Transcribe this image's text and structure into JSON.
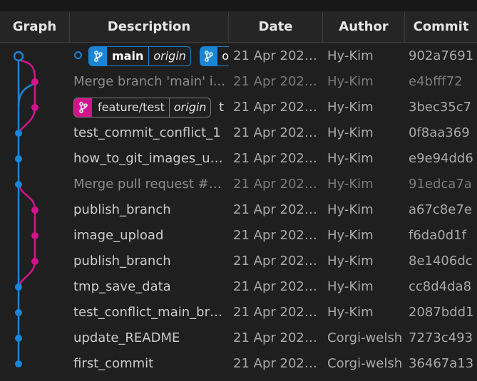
{
  "colors": {
    "blue": "#1a85d6",
    "pink": "#d2148c"
  },
  "columns": {
    "graph": "Graph",
    "description": "Description",
    "date": "Date",
    "author": "Author",
    "commit": "Commit"
  },
  "commits": [
    {
      "description": "",
      "date": "21 Apr 2025...",
      "author": "Hy-Kim",
      "commit": "902a7691",
      "dim": false,
      "lane": "blue",
      "head": true
    },
    {
      "description": "Merge branch 'main' i...",
      "date": "21 Apr 2025...",
      "author": "Hy-Kim",
      "commit": "e4bfff72",
      "dim": true,
      "lane": "pink"
    },
    {
      "description": "t",
      "date": "21 Apr 2025...",
      "author": "Hy-Kim",
      "commit": "3bec35c7",
      "dim": false,
      "lane": "pink"
    },
    {
      "description": "test_commit_conflict_1",
      "date": "21 Apr 2025...",
      "author": "Hy-Kim",
      "commit": "0f8aa369",
      "dim": false,
      "lane": "blue"
    },
    {
      "description": "how_to_git_images_up...",
      "date": "21 Apr 2025...",
      "author": "Hy-Kim",
      "commit": "e9e94dd6",
      "dim": false,
      "lane": "blue"
    },
    {
      "description": "Merge pull request #1 ...",
      "date": "21 Apr 2025...",
      "author": "Hy-Kim",
      "commit": "91edca7a",
      "dim": true,
      "lane": "blue"
    },
    {
      "description": "publish_branch",
      "date": "21 Apr 2025...",
      "author": "Hy-Kim",
      "commit": "a67c8e7e",
      "dim": false,
      "lane": "pink"
    },
    {
      "description": "image_upload",
      "date": "21 Apr 2025...",
      "author": "Hy-Kim",
      "commit": "f6da0d1f",
      "dim": false,
      "lane": "pink"
    },
    {
      "description": "publish_branch",
      "date": "21 Apr 2025...",
      "author": "Hy-Kim",
      "commit": "8e1406dc",
      "dim": false,
      "lane": "pink"
    },
    {
      "description": "tmp_save_data",
      "date": "21 Apr 2025...",
      "author": "Hy-Kim",
      "commit": "cc8d4da8",
      "dim": false,
      "lane": "blue"
    },
    {
      "description": "test_conflict_main_bra...",
      "date": "21 Apr 2025...",
      "author": "Hy-Kim",
      "commit": "2087bdd1",
      "dim": false,
      "lane": "blue"
    },
    {
      "description": "update_README",
      "date": "21 Apr 2025...",
      "author": "Corgi-welsh",
      "commit": "7273c493",
      "dim": false,
      "lane": "blue"
    },
    {
      "description": "first_commit",
      "date": "21 Apr 2025...",
      "author": "Corgi-welsh",
      "commit": "36467a13",
      "dim": false,
      "lane": "blue"
    }
  ],
  "refs": {
    "main": {
      "name": "main",
      "remote": "origin",
      "icon": "branch-icon"
    },
    "main_clipped": {
      "name": "o",
      "icon": "branch-icon"
    },
    "feature": {
      "name": "feature/test",
      "remote": "origin",
      "icon": "branch-icon"
    }
  }
}
